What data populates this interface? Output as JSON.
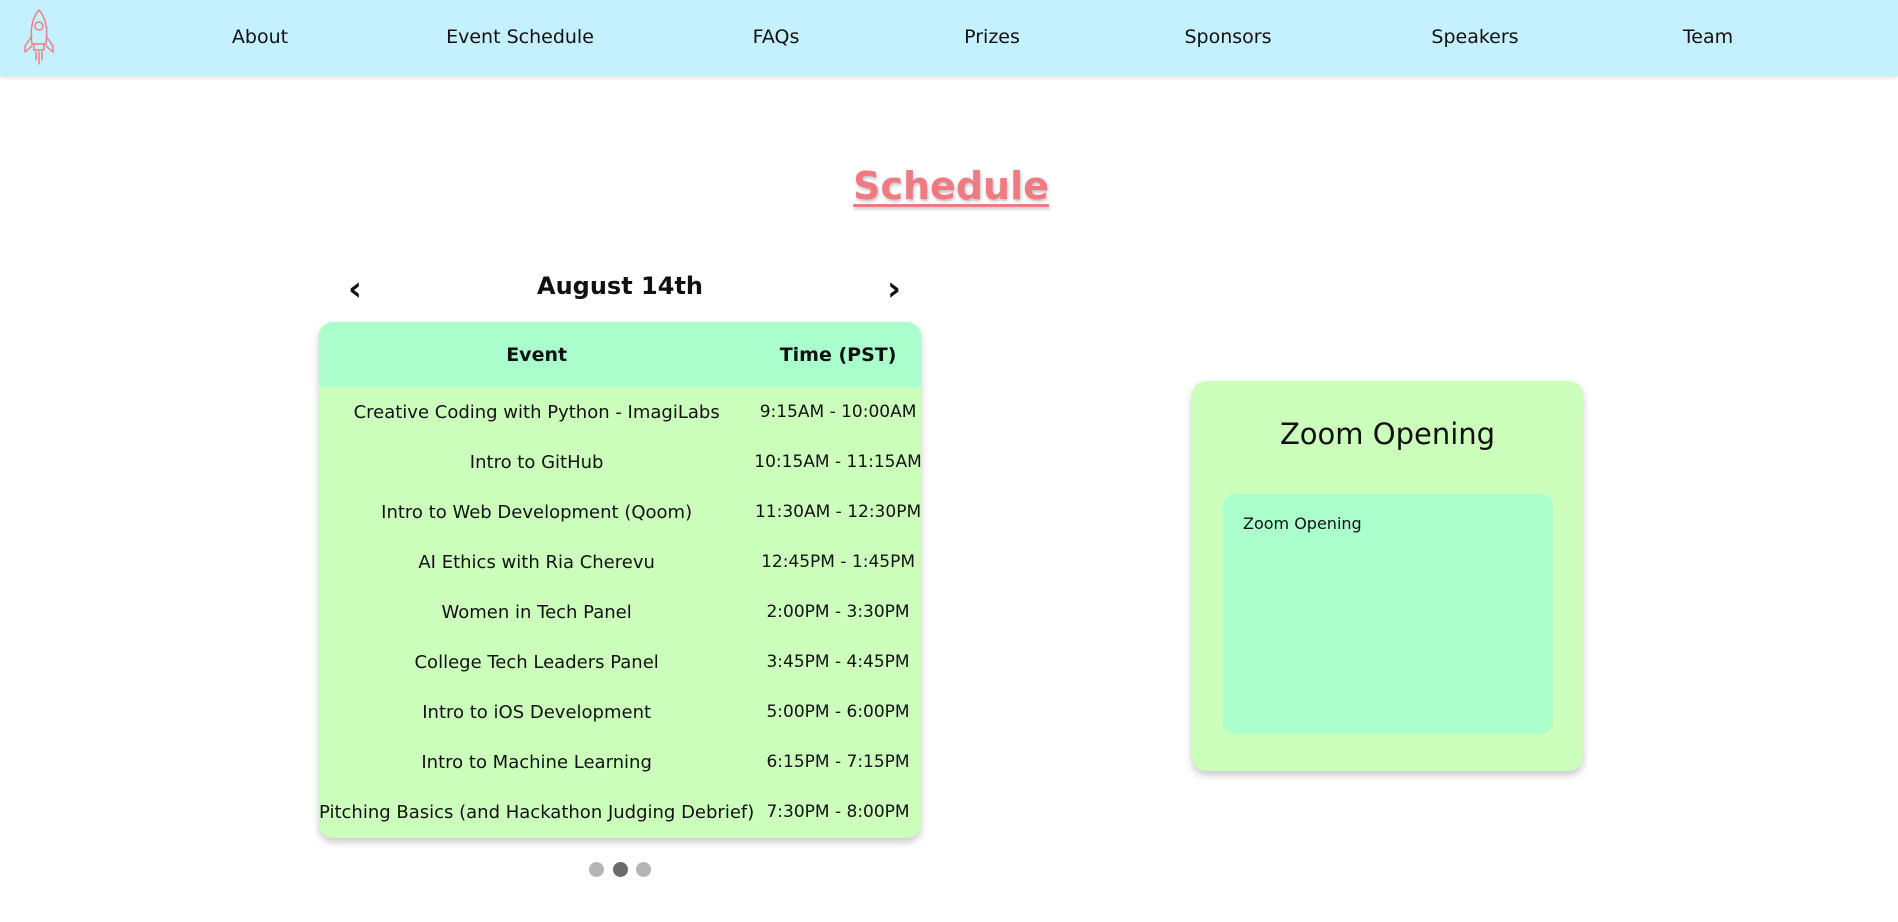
{
  "brand": {
    "logo_icon": "rocket-icon",
    "accent_color": "#f07a82"
  },
  "nav": {
    "background": "#c5f0fd",
    "items": [
      {
        "label": "About"
      },
      {
        "label": "Event Schedule"
      },
      {
        "label": "FAQs"
      },
      {
        "label": "Prizes"
      },
      {
        "label": "Sponsors"
      },
      {
        "label": "Speakers"
      },
      {
        "label": "Team"
      }
    ]
  },
  "page": {
    "title": "Schedule"
  },
  "schedule": {
    "day": "August 14th",
    "prev_icon": "chevron-left-icon",
    "next_icon": "chevron-right-icon",
    "prev_symbol": "‹",
    "next_symbol": "›",
    "columns": {
      "event": "Event",
      "time": "Time (PST)"
    },
    "rows": [
      {
        "event": "Creative Coding with Python - ImagiLabs",
        "time": "9:15AM - 10:00AM"
      },
      {
        "event": "Intro to GitHub",
        "time": "10:15AM - 11:15AM"
      },
      {
        "event": "Intro to Web Development (Qoom)",
        "time": "11:30AM - 12:30PM"
      },
      {
        "event": "AI Ethics with Ria Cherevu",
        "time": "12:45PM - 1:45PM"
      },
      {
        "event": "Women in Tech Panel",
        "time": "2:00PM - 3:30PM"
      },
      {
        "event": "College Tech Leaders Panel",
        "time": "3:45PM - 4:45PM"
      },
      {
        "event": "Intro to iOS Development",
        "time": "5:00PM - 6:00PM"
      },
      {
        "event": "Intro to Machine Learning",
        "time": "6:15PM - 7:15PM"
      },
      {
        "event": "Pitching Basics (and Hackathon Judging Debrief)",
        "time": "7:30PM - 8:00PM"
      }
    ],
    "pager": {
      "count": 3,
      "active_index": 1
    },
    "colors": {
      "header_bg": "#aaffcd",
      "body_bg": "#ccfebc"
    }
  },
  "zoom": {
    "title": "Zoom Opening",
    "body_text": "Zoom Opening"
  }
}
